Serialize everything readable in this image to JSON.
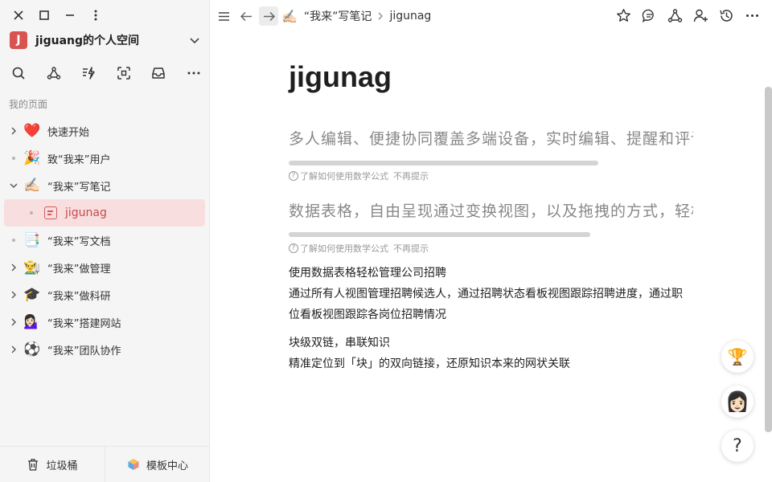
{
  "workspace": {
    "avatar_letter": "J",
    "name": "jiguang的个人空间"
  },
  "sidebar": {
    "section_label": "我的页面",
    "items": [
      {
        "label": "快速开始",
        "emoji": "❤️",
        "state": "collapsed"
      },
      {
        "label": "致“我来”用户",
        "emoji": "🎉",
        "state": "leaf"
      },
      {
        "label": "“我来”写笔记",
        "emoji": "✍🏻",
        "state": "expanded"
      },
      {
        "label": "jigunag",
        "emoji": "",
        "state": "active-child"
      },
      {
        "label": "“我来”写文档",
        "emoji": "📑",
        "state": "leaf"
      },
      {
        "label": "“我来”做管理",
        "emoji": "👨‍🌾",
        "state": "collapsed"
      },
      {
        "label": "“我来”做科研",
        "emoji": "🎓",
        "state": "collapsed"
      },
      {
        "label": "“我来”搭建网站",
        "emoji": "💁🏻‍♀️",
        "state": "collapsed"
      },
      {
        "label": "“我来”团队协作",
        "emoji": "⚽",
        "state": "collapsed"
      }
    ],
    "footer": {
      "trash_label": "垃圾桶",
      "templates_label": "模板中心"
    }
  },
  "breadcrumb": {
    "parent_emoji": "✍🏻",
    "parent": "“我来”写笔记",
    "current": "jigunag"
  },
  "page": {
    "title": "jigunag",
    "formula1": "多人编辑、便捷协同覆盖多端设备，实时编辑、提醒和评论",
    "formula2": "数据表格，自由呈现通过变换视图，以及拖拽的方式，轻松",
    "hint_text": "了解如何使用数学公式",
    "hint_dismiss": "不再提示",
    "para1": "使用数据表格轻松管理公司招聘",
    "para2": "通过所有人视图管理招聘候选人，通过招聘状态看板视图跟踪招聘进度，通过职位看板视图跟踪各岗位招聘情况",
    "para3": "块级双链，串联知识",
    "para4": "精准定位到「块」的双向链接，还原知识本来的网状关联"
  },
  "floating": {
    "trophy_emoji": "🏆",
    "avatar_emoji": "👩🏻",
    "help_label": "?"
  },
  "colors": {
    "accent": "#d9534f",
    "active_bg": "#f8dede"
  }
}
